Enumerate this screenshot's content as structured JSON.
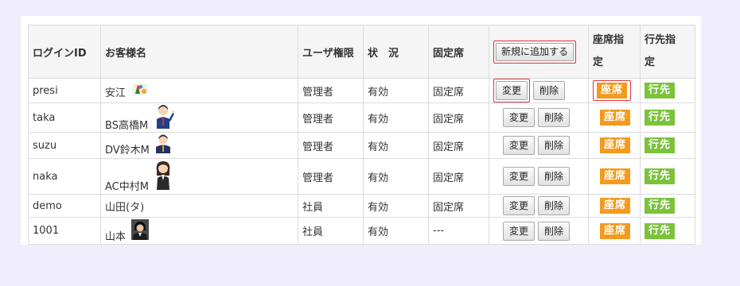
{
  "table": {
    "headers": {
      "login_id": "ログインID",
      "customer_name": "お客様名",
      "user_role": "ユーザ権限",
      "status": "状　況",
      "fixed_seat": "固定席",
      "add_button": "新規に追加する",
      "seat_assign_1": "座席指",
      "seat_assign_2": "定",
      "dest_assign_1": "行先指",
      "dest_assign_2": "定"
    },
    "change_label": "変更",
    "delete_label": "削除",
    "seat_label": "座席",
    "dest_label": "行先",
    "rows": [
      {
        "login_id": "presi",
        "name": "安江",
        "role": "管理者",
        "status": "有効",
        "fixed_seat": "固定席",
        "avatar": "flag-icon"
      },
      {
        "login_id": "taka",
        "name": "BS高橋M",
        "role": "管理者",
        "status": "有効",
        "fixed_seat": "固定席",
        "avatar": "businessman-waving-icon"
      },
      {
        "login_id": "suzu",
        "name": "DV鈴木M",
        "role": "管理者",
        "status": "有効",
        "fixed_seat": "固定席",
        "avatar": "businessman-icon"
      },
      {
        "login_id": "naka",
        "name": "AC中村M",
        "role": "管理者",
        "status": "有効",
        "fixed_seat": "固定席",
        "avatar": "businesswoman-icon"
      },
      {
        "login_id": "demo",
        "name": "山田(タ)",
        "role": "社員",
        "status": "有効",
        "fixed_seat": "固定席",
        "avatar": ""
      },
      {
        "login_id": "1001",
        "name": "山本",
        "role": "社員",
        "status": "有効",
        "fixed_seat": "---",
        "avatar": "woman-photo-icon"
      }
    ]
  },
  "colors": {
    "seat_tag": "#f39a1f",
    "dest_tag": "#7cc23c",
    "highlight_outline": "#e4343c",
    "page_background": "#f0eefd"
  }
}
